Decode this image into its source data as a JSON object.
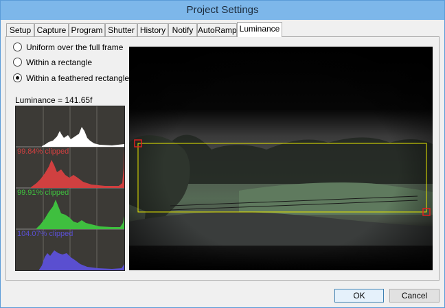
{
  "window": {
    "title": "Project Settings"
  },
  "tabs": [
    {
      "label": "Setup"
    },
    {
      "label": "Capture"
    },
    {
      "label": "Program"
    },
    {
      "label": "Shutter"
    },
    {
      "label": "History"
    },
    {
      "label": "Notify"
    },
    {
      "label": "AutoRamp"
    },
    {
      "label": "Luminance",
      "active": true
    }
  ],
  "metering": {
    "options": [
      {
        "label": "Uniform over the full frame",
        "checked": false
      },
      {
        "label": "Within a rectangle",
        "checked": false
      },
      {
        "label": "Within a feathered rectangle",
        "checked": true
      }
    ]
  },
  "luminance": {
    "label": "Luminance = 141.65f"
  },
  "histogram": {
    "channels": [
      {
        "name": "luminance",
        "color": "#ffffff",
        "clip_label": ""
      },
      {
        "name": "red",
        "color": "#d04040",
        "clip_label": "99.84% clipped"
      },
      {
        "name": "green",
        "color": "#3fbf3f",
        "clip_label": "99.91% clipped"
      },
      {
        "name": "blue",
        "color": "#5a4fd0",
        "clip_label": "104.07% clipped"
      }
    ]
  },
  "colors": {
    "selection_rect": "#e8e800",
    "handle": "#e02020",
    "titlebar": "#7db7ea"
  },
  "buttons": {
    "ok": "OK",
    "cancel": "Cancel"
  }
}
